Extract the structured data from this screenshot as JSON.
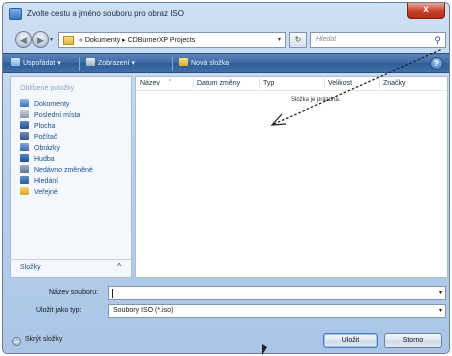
{
  "window": {
    "title": "Zvolte cestu a jméno souboru pro obraz ISO",
    "close_glyph": "x"
  },
  "address": {
    "path": "« Dokumenty ▸ CDBurnerXP Projects",
    "search_placeholder": "Hledat"
  },
  "toolbar": {
    "organize_label": "Uspořádat ▾",
    "views_label": "Zobrazení ▾",
    "new_folder_label": "Nová složka",
    "help_glyph": "?"
  },
  "left_pane": {
    "header": "Oblíbené položky",
    "items": [
      {
        "label": "Dokumenty",
        "icon": "documents-icon"
      },
      {
        "label": "Poslední místa",
        "icon": "recent-places-icon"
      },
      {
        "label": "Plocha",
        "icon": "desktop-icon"
      },
      {
        "label": "Počítač",
        "icon": "computer-icon"
      },
      {
        "label": "Obrázky",
        "icon": "pictures-icon"
      },
      {
        "label": "Hudba",
        "icon": "music-icon"
      },
      {
        "label": "Nedávno změněné",
        "icon": "recently-changed-icon"
      },
      {
        "label": "Hledání",
        "icon": "searches-icon"
      },
      {
        "label": "Veřejné",
        "icon": "public-folder-icon"
      }
    ],
    "folders_label": "Složky",
    "folders_chevron": "^"
  },
  "file_list": {
    "columns": [
      "Název",
      "Datum změny",
      "Typ",
      "Velikost",
      "Značky"
    ],
    "empty_message": "Složka je prázdná."
  },
  "form": {
    "filename_label": "Název souboru:",
    "filename_value": "",
    "filetype_label": "Uložit jako typ:",
    "filetype_value": "Soubory ISO (*.iso)"
  },
  "footer": {
    "hide_folders_label": "Skrýt složky",
    "open_label": "Uložit",
    "cancel_label": "Storno"
  },
  "colors": {
    "toolbar": "#3d6aa3",
    "link_text": "#1d4f91",
    "close_button": "#c7402c"
  }
}
